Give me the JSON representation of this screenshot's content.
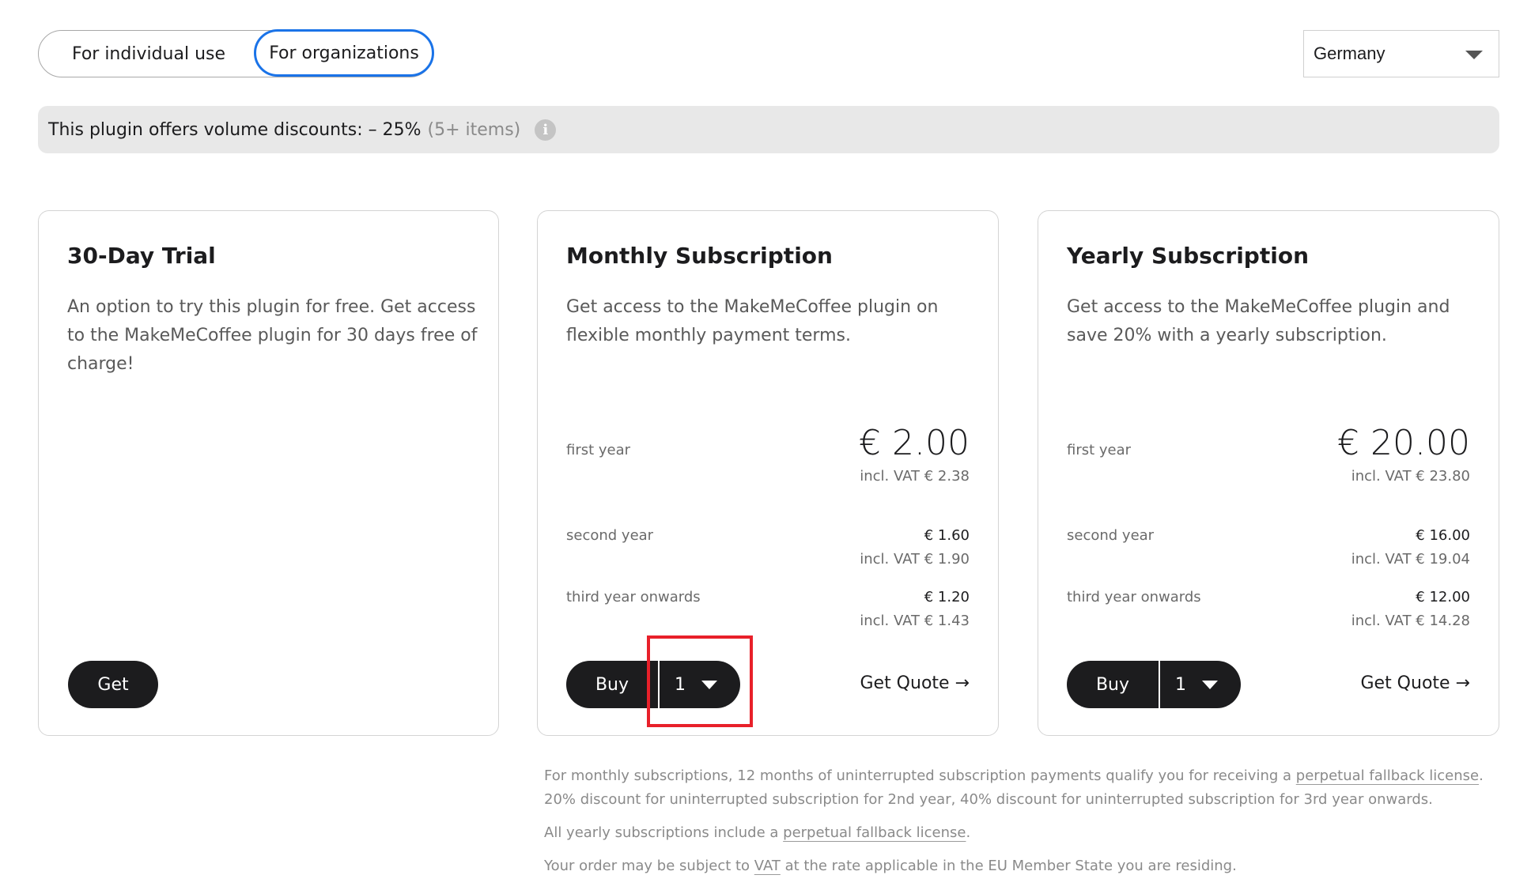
{
  "audience_toggle": {
    "options": [
      "For individual use",
      "For organizations"
    ],
    "selected": "For organizations"
  },
  "country_select": {
    "value": "Germany"
  },
  "banner": {
    "text": "This plugin offers volume discounts: – 25%",
    "muted": "(5+ items)",
    "info_icon": "info-icon"
  },
  "cards": [
    {
      "title": "30-Day Trial",
      "description": "An option to try this plugin for free. Get access to the MakeMeCoffee plugin for 30 days free of charge!",
      "button": "Get"
    },
    {
      "title": "Monthly Subscription",
      "description": "Get access to the MakeMeCoffee plugin on flexible monthly payment terms.",
      "prices": [
        {
          "label": "first year",
          "amount": "€ 2.00",
          "vat": "incl. VAT € 2.38"
        },
        {
          "label": "second year",
          "amount": "€ 1.60",
          "vat": "incl. VAT € 1.90"
        },
        {
          "label": "third year onwards",
          "amount": "€ 1.20",
          "vat": "incl. VAT € 1.43"
        }
      ],
      "buy_label": "Buy",
      "quantity": "1",
      "quote_label": "Get Quote →"
    },
    {
      "title": "Yearly Subscription",
      "description": "Get access to the MakeMeCoffee plugin and save 20% with a yearly subscription.",
      "prices": [
        {
          "label": "first year",
          "amount": "€ 20.00",
          "vat": "incl. VAT € 23.80"
        },
        {
          "label": "second year",
          "amount": "€ 16.00",
          "vat": "incl. VAT € 19.04"
        },
        {
          "label": "third year onwards",
          "amount": "€ 12.00",
          "vat": "incl. VAT € 14.28"
        }
      ],
      "buy_label": "Buy",
      "quantity": "1",
      "quote_label": "Get Quote →"
    }
  ],
  "notes": {
    "monthly_prefix": "For monthly subscriptions, 12 months of uninterrupted subscription payments qualify you for receiving a ",
    "monthly_link": "perpetual fallback license",
    "monthly_suffix": ".",
    "monthly_line2": "20% discount for uninterrupted subscription for 2nd year, 40% discount for uninterrupted subscription for 3rd year onwards.",
    "yearly_prefix": "All yearly subscriptions include a ",
    "yearly_link": "perpetual fallback license",
    "yearly_suffix": ".",
    "vat_prefix": "Your order may be subject to ",
    "vat_link": "VAT",
    "vat_suffix": " at the rate applicable in the EU Member State you are residing."
  },
  "highlight": {
    "color": "#e8202a",
    "target": "monthly-quantity-dropdown"
  },
  "colors": {
    "accent": "#1a73e8",
    "button": "#1c1c1e",
    "banner_bg": "#e8e8e8"
  }
}
